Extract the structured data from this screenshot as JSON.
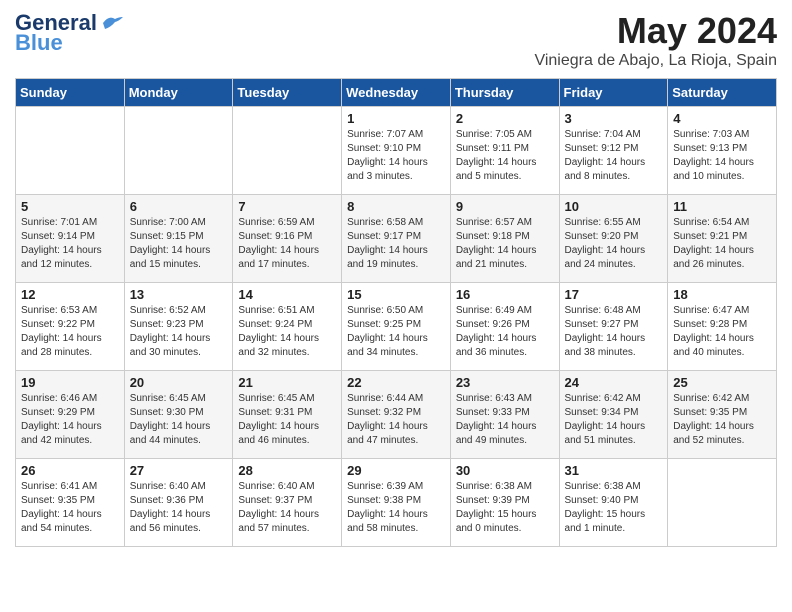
{
  "header": {
    "logo_main": "General",
    "logo_sub": "Blue",
    "month_title": "May 2024",
    "location": "Viniegra de Abajo, La Rioja, Spain"
  },
  "days_of_week": [
    "Sunday",
    "Monday",
    "Tuesday",
    "Wednesday",
    "Thursday",
    "Friday",
    "Saturday"
  ],
  "weeks": [
    [
      {
        "day": "",
        "info": ""
      },
      {
        "day": "",
        "info": ""
      },
      {
        "day": "",
        "info": ""
      },
      {
        "day": "1",
        "info": "Sunrise: 7:07 AM\nSunset: 9:10 PM\nDaylight: 14 hours\nand 3 minutes."
      },
      {
        "day": "2",
        "info": "Sunrise: 7:05 AM\nSunset: 9:11 PM\nDaylight: 14 hours\nand 5 minutes."
      },
      {
        "day": "3",
        "info": "Sunrise: 7:04 AM\nSunset: 9:12 PM\nDaylight: 14 hours\nand 8 minutes."
      },
      {
        "day": "4",
        "info": "Sunrise: 7:03 AM\nSunset: 9:13 PM\nDaylight: 14 hours\nand 10 minutes."
      }
    ],
    [
      {
        "day": "5",
        "info": "Sunrise: 7:01 AM\nSunset: 9:14 PM\nDaylight: 14 hours\nand 12 minutes."
      },
      {
        "day": "6",
        "info": "Sunrise: 7:00 AM\nSunset: 9:15 PM\nDaylight: 14 hours\nand 15 minutes."
      },
      {
        "day": "7",
        "info": "Sunrise: 6:59 AM\nSunset: 9:16 PM\nDaylight: 14 hours\nand 17 minutes."
      },
      {
        "day": "8",
        "info": "Sunrise: 6:58 AM\nSunset: 9:17 PM\nDaylight: 14 hours\nand 19 minutes."
      },
      {
        "day": "9",
        "info": "Sunrise: 6:57 AM\nSunset: 9:18 PM\nDaylight: 14 hours\nand 21 minutes."
      },
      {
        "day": "10",
        "info": "Sunrise: 6:55 AM\nSunset: 9:20 PM\nDaylight: 14 hours\nand 24 minutes."
      },
      {
        "day": "11",
        "info": "Sunrise: 6:54 AM\nSunset: 9:21 PM\nDaylight: 14 hours\nand 26 minutes."
      }
    ],
    [
      {
        "day": "12",
        "info": "Sunrise: 6:53 AM\nSunset: 9:22 PM\nDaylight: 14 hours\nand 28 minutes."
      },
      {
        "day": "13",
        "info": "Sunrise: 6:52 AM\nSunset: 9:23 PM\nDaylight: 14 hours\nand 30 minutes."
      },
      {
        "day": "14",
        "info": "Sunrise: 6:51 AM\nSunset: 9:24 PM\nDaylight: 14 hours\nand 32 minutes."
      },
      {
        "day": "15",
        "info": "Sunrise: 6:50 AM\nSunset: 9:25 PM\nDaylight: 14 hours\nand 34 minutes."
      },
      {
        "day": "16",
        "info": "Sunrise: 6:49 AM\nSunset: 9:26 PM\nDaylight: 14 hours\nand 36 minutes."
      },
      {
        "day": "17",
        "info": "Sunrise: 6:48 AM\nSunset: 9:27 PM\nDaylight: 14 hours\nand 38 minutes."
      },
      {
        "day": "18",
        "info": "Sunrise: 6:47 AM\nSunset: 9:28 PM\nDaylight: 14 hours\nand 40 minutes."
      }
    ],
    [
      {
        "day": "19",
        "info": "Sunrise: 6:46 AM\nSunset: 9:29 PM\nDaylight: 14 hours\nand 42 minutes."
      },
      {
        "day": "20",
        "info": "Sunrise: 6:45 AM\nSunset: 9:30 PM\nDaylight: 14 hours\nand 44 minutes."
      },
      {
        "day": "21",
        "info": "Sunrise: 6:45 AM\nSunset: 9:31 PM\nDaylight: 14 hours\nand 46 minutes."
      },
      {
        "day": "22",
        "info": "Sunrise: 6:44 AM\nSunset: 9:32 PM\nDaylight: 14 hours\nand 47 minutes."
      },
      {
        "day": "23",
        "info": "Sunrise: 6:43 AM\nSunset: 9:33 PM\nDaylight: 14 hours\nand 49 minutes."
      },
      {
        "day": "24",
        "info": "Sunrise: 6:42 AM\nSunset: 9:34 PM\nDaylight: 14 hours\nand 51 minutes."
      },
      {
        "day": "25",
        "info": "Sunrise: 6:42 AM\nSunset: 9:35 PM\nDaylight: 14 hours\nand 52 minutes."
      }
    ],
    [
      {
        "day": "26",
        "info": "Sunrise: 6:41 AM\nSunset: 9:35 PM\nDaylight: 14 hours\nand 54 minutes."
      },
      {
        "day": "27",
        "info": "Sunrise: 6:40 AM\nSunset: 9:36 PM\nDaylight: 14 hours\nand 56 minutes."
      },
      {
        "day": "28",
        "info": "Sunrise: 6:40 AM\nSunset: 9:37 PM\nDaylight: 14 hours\nand 57 minutes."
      },
      {
        "day": "29",
        "info": "Sunrise: 6:39 AM\nSunset: 9:38 PM\nDaylight: 14 hours\nand 58 minutes."
      },
      {
        "day": "30",
        "info": "Sunrise: 6:38 AM\nSunset: 9:39 PM\nDaylight: 15 hours\nand 0 minutes."
      },
      {
        "day": "31",
        "info": "Sunrise: 6:38 AM\nSunset: 9:40 PM\nDaylight: 15 hours\nand 1 minute."
      },
      {
        "day": "",
        "info": ""
      }
    ]
  ]
}
